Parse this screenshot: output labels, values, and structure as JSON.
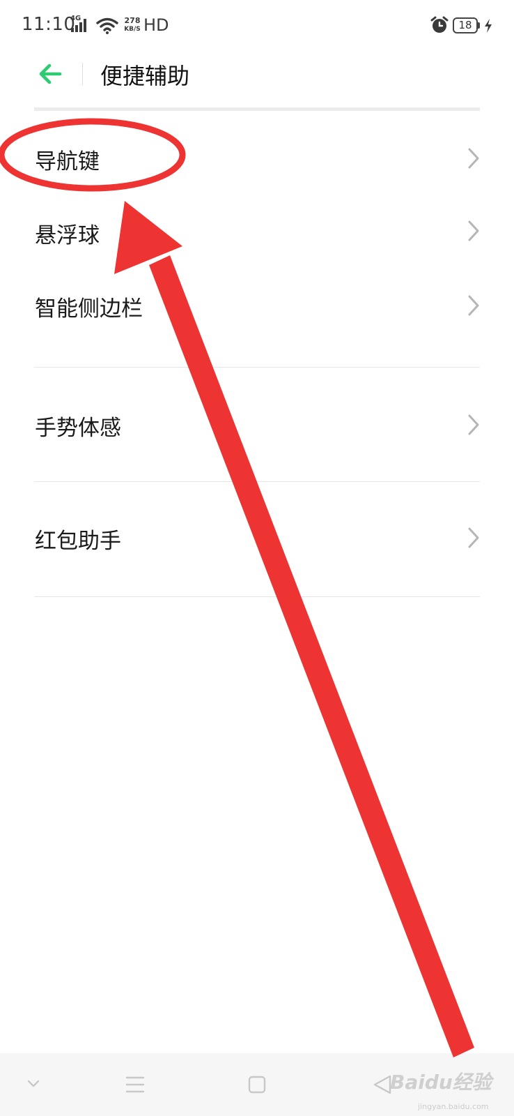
{
  "status_bar": {
    "time": "11:10",
    "network_type": "4G",
    "speed_value": "278",
    "speed_unit": "KB/S",
    "hd_label": "HD",
    "battery_level": "18"
  },
  "header": {
    "title": "便捷辅助",
    "back_icon": "back-arrow-icon",
    "accent_color": "#2ecc71"
  },
  "menu": {
    "items": [
      {
        "label": "导航键"
      },
      {
        "label": "悬浮球"
      },
      {
        "label": "智能侧边栏"
      },
      {
        "label": "手势体感"
      },
      {
        "label": "红包助手"
      }
    ]
  },
  "bottom_nav": {
    "buttons": [
      "collapse-chevron-icon",
      "menu-icon",
      "home-square-icon",
      "back-triangle-icon"
    ]
  },
  "annotation": {
    "color": "#ee3333",
    "shapes": [
      "highlight-ellipse",
      "pointer-arrow"
    ]
  },
  "watermark": {
    "logo_text": "Baidu经验",
    "domain_text": "jingyan.baidu.com"
  }
}
